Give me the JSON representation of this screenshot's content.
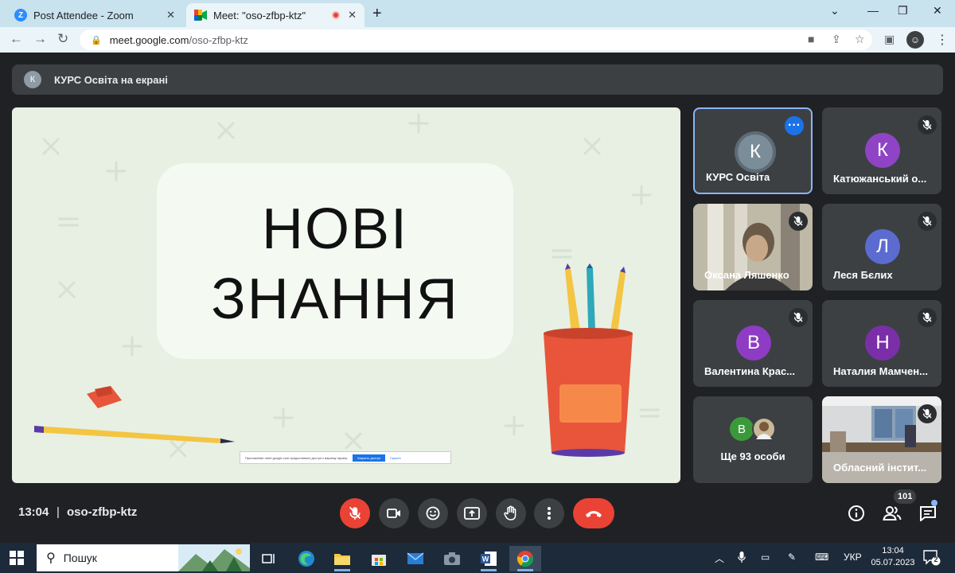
{
  "browser": {
    "tabs": [
      {
        "title": "Post Attendee - Zoom",
        "favicon": "zoom-logo",
        "favicon_letter": "Z",
        "active": false
      },
      {
        "title": "Meet: \"oso-zfbp-ktz\"",
        "favicon": "google-meet-logo",
        "active": true,
        "recording": true
      }
    ],
    "url_domain": "meet.google.com",
    "url_path": "/oso-zfbp-ktz",
    "profile_initial": "☺"
  },
  "presentation": {
    "presenter_initial": "К",
    "label": "КУРС Освіта на екрані"
  },
  "slide": {
    "line1": "НОВІ",
    "line2": "ЗНАННЯ",
    "notice_text": "Приложение meet.google.com предоставило доступ к вашему экрану.",
    "notice_button": "Закрыть доступ",
    "notice_link": "Скрыть"
  },
  "participants": [
    {
      "name": "КУРС Освіта",
      "initial": "К",
      "color": "#7b8d99",
      "muted": false,
      "selected": true
    },
    {
      "name": "Катюжанський о...",
      "initial": "К",
      "color": "#8e44c4",
      "muted": true
    },
    {
      "name": "Оксана Ляшенко",
      "video": true,
      "muted": true
    },
    {
      "name": "Леся Бєлих",
      "initial": "Л",
      "color": "#5b6bd0",
      "muted": true
    },
    {
      "name": "Валентина Крас...",
      "initial": "В",
      "color": "#8e3cc4",
      "muted": true
    },
    {
      "name": "Наталия Мамчен...",
      "initial": "Н",
      "color": "#7a2fa8",
      "muted": true
    },
    {
      "more_label": "Ще 93 особи",
      "initial": "В",
      "color": "#3a9a3a"
    },
    {
      "name": "Обласний інстит...",
      "video": true,
      "muted": true
    }
  ],
  "bottom_bar": {
    "time": "13:04",
    "separator": "|",
    "meeting_code": "oso-zfbp-ktz",
    "participant_count": "101"
  },
  "taskbar": {
    "search_placeholder": "Пошук",
    "language": "УКР",
    "time": "13:04",
    "date": "05.07.2023",
    "notification_count": "2"
  },
  "colors": {
    "meet_bg": "#202124",
    "tile_bg": "#3c4043",
    "end_call": "#ea4335",
    "accent_blue": "#1a73e8",
    "chrome_tabbar": "#c8e2ee"
  }
}
